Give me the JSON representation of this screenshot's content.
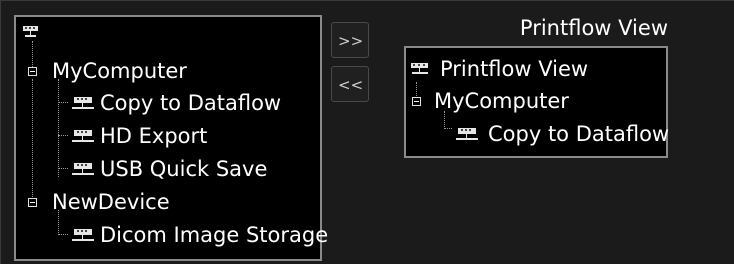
{
  "transfer_buttons": {
    "add_label": ">>",
    "remove_label": "<<"
  },
  "left_tree": {
    "root_icon": "computer-icon",
    "nodes": [
      {
        "label": "MyComputer",
        "icon": "expander-minus"
      },
      {
        "label": "Copy to Dataflow",
        "icon": "device-icon"
      },
      {
        "label": "HD Export",
        "icon": "device-icon"
      },
      {
        "label": "USB Quick Save",
        "icon": "device-icon"
      },
      {
        "label": "NewDevice",
        "icon": "expander-minus"
      },
      {
        "label": "Dicom Image Storage",
        "icon": "device-icon"
      }
    ]
  },
  "right_panel": {
    "title": "Printflow View",
    "nodes": [
      {
        "label": "Printflow View",
        "icon": "computer-icon"
      },
      {
        "label": "MyComputer",
        "icon": "expander-minus"
      },
      {
        "label": "Copy to Dataflow",
        "icon": "device-icon"
      }
    ]
  },
  "colors": {
    "background": "#1b1b1b",
    "panel": "#000000",
    "panel_border": "#8a8a8a",
    "text": "#ffffff"
  }
}
